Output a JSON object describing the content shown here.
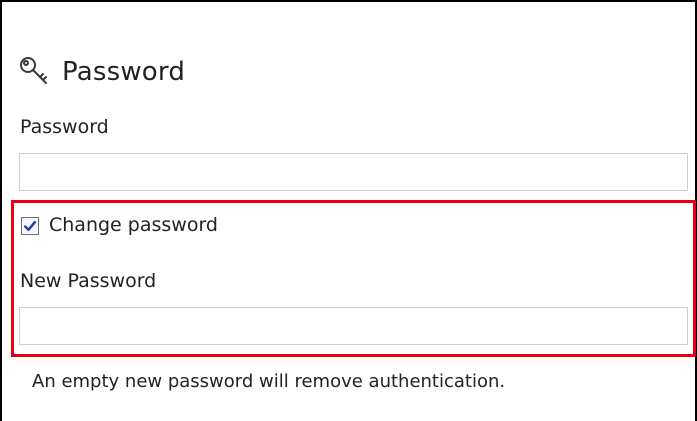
{
  "section": {
    "title": "Password",
    "icon": "key-icon"
  },
  "password": {
    "label": "Password",
    "value": "",
    "placeholder": ""
  },
  "change_password": {
    "label": "Change password",
    "checked": true
  },
  "new_password": {
    "label": "New Password",
    "value": "",
    "placeholder": ""
  },
  "note": "An empty new password will remove authentication.",
  "colors": {
    "highlight": "#e20010",
    "checkbox_check": "#1f3f95"
  }
}
